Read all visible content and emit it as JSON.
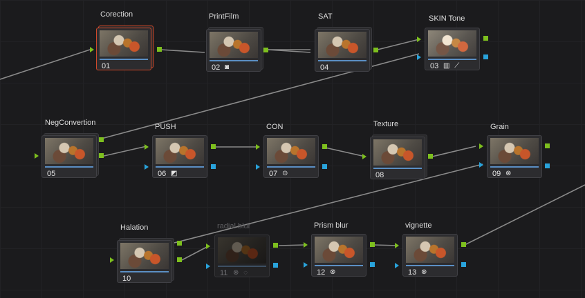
{
  "nodes": [
    {
      "label": "Corection",
      "num": "01",
      "icons": ""
    },
    {
      "label": "PrintFilm",
      "num": "02",
      "icons": "◙"
    },
    {
      "label": "SAT",
      "num": "04",
      "icons": ""
    },
    {
      "label": "SKIN Tone",
      "num": "03",
      "icons": "▥ ⟋"
    },
    {
      "label": "NegConvertion",
      "num": "05",
      "icons": ""
    },
    {
      "label": "PUSH",
      "num": "06",
      "icons": "◩"
    },
    {
      "label": "CON",
      "num": "07",
      "icons": "⊙"
    },
    {
      "label": "Texture",
      "num": "08",
      "icons": ""
    },
    {
      "label": "Grain",
      "num": "09",
      "icons": "⊗"
    },
    {
      "label": "Halation",
      "num": "10",
      "icons": ""
    },
    {
      "label": "radial blur",
      "num": "11",
      "icons": "⊗ ◌"
    },
    {
      "label": "Prism blur",
      "num": "12",
      "icons": "⊗"
    },
    {
      "label": "vignette",
      "num": "13",
      "icons": "⊗"
    }
  ],
  "colors": {
    "background": "#1b1b1d",
    "rgb_port": "#7dbf1e",
    "alpha_port": "#29a3db",
    "selected_border": "#d0492b",
    "wire": "#8a8a8a"
  }
}
